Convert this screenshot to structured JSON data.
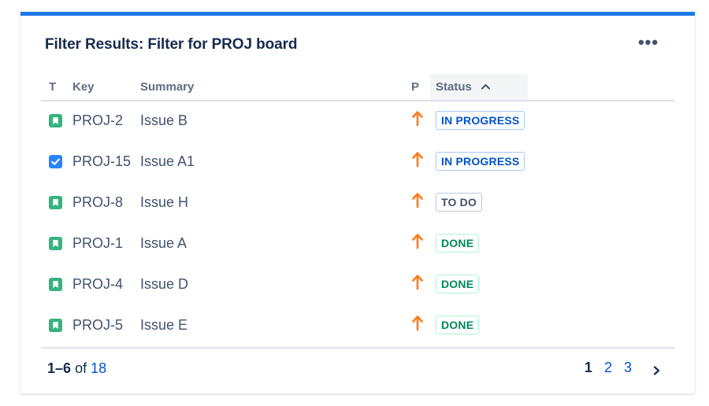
{
  "gadget": {
    "title": "Filter Results: Filter for PROJ board",
    "more_icon": "more-horizontal-icon",
    "more_label": "•••"
  },
  "columns": {
    "type": "T",
    "key": "Key",
    "summary": "Summary",
    "priority": "P",
    "status": "Status",
    "status_sort_icon": "chevron-up-icon",
    "status_sort_glyph": "^"
  },
  "issues": [
    {
      "type": "story",
      "key": "PROJ-2",
      "summary": "Issue B",
      "priority": "high",
      "status": "IN PROGRESS",
      "status_category": "inprogress"
    },
    {
      "type": "task",
      "key": "PROJ-15",
      "summary": "Issue A1",
      "priority": "high",
      "status": "IN PROGRESS",
      "status_category": "inprogress"
    },
    {
      "type": "story",
      "key": "PROJ-8",
      "summary": "Issue H",
      "priority": "high",
      "status": "TO DO",
      "status_category": "todo"
    },
    {
      "type": "story",
      "key": "PROJ-1",
      "summary": "Issue A",
      "priority": "high",
      "status": "DONE",
      "status_category": "done"
    },
    {
      "type": "story",
      "key": "PROJ-4",
      "summary": "Issue D",
      "priority": "high",
      "status": "DONE",
      "status_category": "done"
    },
    {
      "type": "story",
      "key": "PROJ-5",
      "summary": "Issue E",
      "priority": "high",
      "status": "DONE",
      "status_category": "done"
    }
  ],
  "footer": {
    "range": "1–6",
    "of": "of",
    "total": "18",
    "pages": [
      "1",
      "2",
      "3"
    ],
    "current_page": "1",
    "next_glyph": "›",
    "next_icon": "chevron-right-icon"
  },
  "colors": {
    "accent_bar": "#1f7ae8",
    "story_icon": "#36b37e",
    "task_icon": "#2684ff",
    "priority_high": "#ff7a1a"
  }
}
